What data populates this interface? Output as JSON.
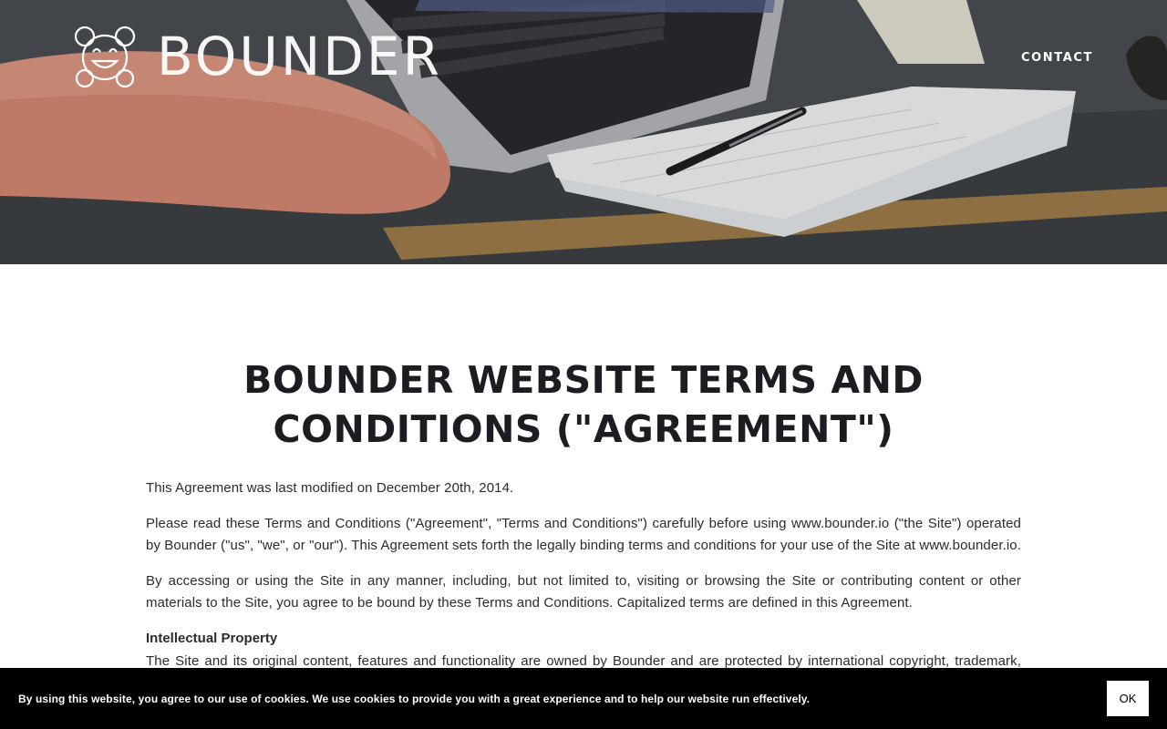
{
  "brand": {
    "name": "BOUNDER"
  },
  "nav": {
    "contact_label": "CONTACT"
  },
  "page": {
    "title": "BOUNDER WEBSITE TERMS AND CONDITIONS (\"AGREEMENT\")",
    "paragraphs": [
      "This Agreement was last modified on December 20th, 2014.",
      "Please read these Terms and Conditions (\"Agreement\", \"Terms and Conditions\") carefully before using www.bounder.io (\"the Site\") operated by Bounder (\"us\", \"we\", or \"our\"). This Agreement sets forth the legally binding terms and conditions for your use of the Site at www.bounder.io.",
      "By accessing or using the Site in any manner, including, but not limited to, visiting or browsing the Site or contributing content or other materials to the Site, you agree to be bound by these Terms and Conditions. Capitalized terms are defined in this Agreement."
    ],
    "sections": [
      {
        "heading": "Intellectual Property",
        "body": "The Site and its original content, features and functionality are owned by Bounder and are protected by international copyright, trademark, patent,"
      }
    ]
  },
  "cookie_banner": {
    "text": "By using this website, you agree to our use of cookies. We use cookies to provide you with a great experience and to help our website run effectively.",
    "ok_label": "OK"
  },
  "icons": {
    "logo": "smiling-face-logo-icon"
  }
}
